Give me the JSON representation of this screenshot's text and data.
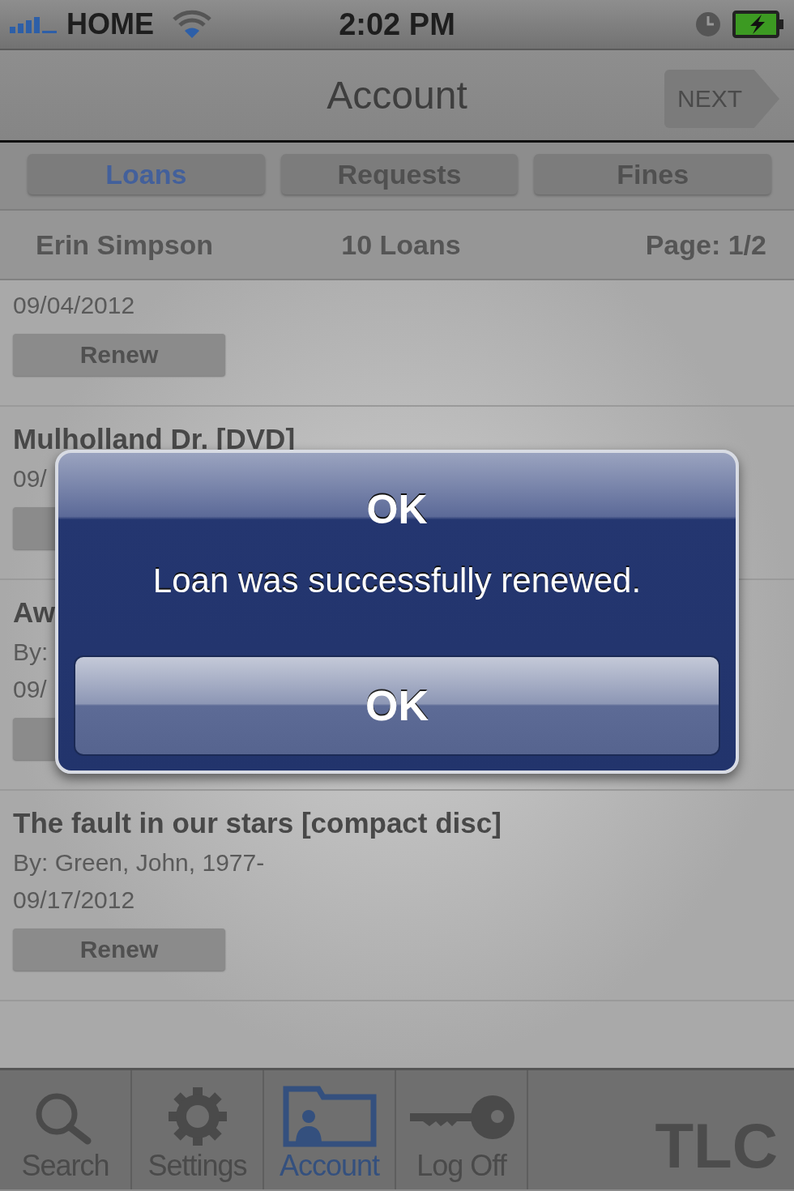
{
  "status_bar": {
    "carrier": "HOME",
    "time": "2:02 PM"
  },
  "nav": {
    "title": "Account",
    "next_button": "NEXT"
  },
  "tabs": [
    {
      "label": "Loans",
      "selected": true
    },
    {
      "label": "Requests",
      "selected": false
    },
    {
      "label": "Fines",
      "selected": false
    }
  ],
  "summary": {
    "patron": "Erin Simpson",
    "count": "10 Loans",
    "page": "Page: 1/2"
  },
  "loans": [
    {
      "date": "09/04/2012",
      "action": "Renew"
    },
    {
      "title": "Mulholland Dr. [DVD]",
      "date": "09/"
    },
    {
      "title": "Aw",
      "author": "By:",
      "date": "09/"
    },
    {
      "title": "The fault in our stars [compact disc]",
      "author": "By: Green, John, 1977-",
      "date": "09/17/2012",
      "action": "Renew"
    }
  ],
  "alert": {
    "title": "OK",
    "message": "Loan was successfully renewed.",
    "button": "OK"
  },
  "tab_bar": [
    {
      "kind": "search",
      "label": "Search",
      "selected": false
    },
    {
      "kind": "settings",
      "label": "Settings",
      "selected": false
    },
    {
      "kind": "account",
      "label": "Account",
      "selected": true
    },
    {
      "kind": "logoff",
      "label": "Log Off",
      "selected": false
    }
  ],
  "logo": "TLC"
}
